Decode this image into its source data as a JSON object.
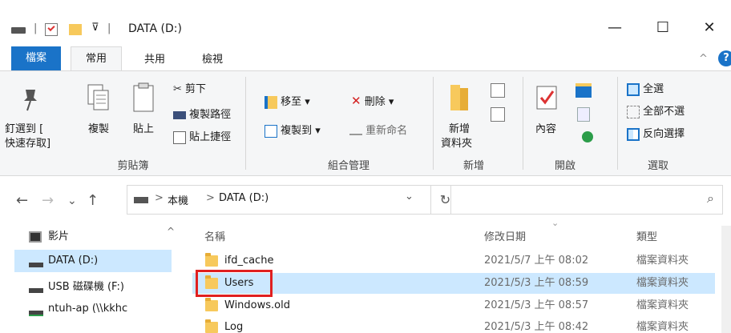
{
  "window": {
    "title": "DATA (D:)",
    "minimize_glyph": "—",
    "maximize_glyph": "☐",
    "close_glyph": "✕"
  },
  "quick_access": {
    "separator": "|",
    "dropdown": "⊽"
  },
  "tabs": [
    {
      "label": "檔案"
    },
    {
      "label": "常用"
    },
    {
      "label": "共用"
    },
    {
      "label": "檢視"
    }
  ],
  "ribbon": {
    "clipboard": {
      "group_label": "剪貼簿",
      "pin_label_1": "釘選到 [",
      "pin_label_2": "快速存取]",
      "copy_label": "複製",
      "paste_label": "貼上",
      "cut_label": "剪下",
      "copy_path_label": "複製路徑",
      "paste_shortcut_label": "貼上捷徑"
    },
    "organize": {
      "group_label": "組合管理",
      "move_to_label": "移至 ▾",
      "delete_label": "刪除 ▾",
      "copy_to_label": "複製到 ▾",
      "rename_label": "重新命名"
    },
    "new": {
      "group_label": "新增",
      "new_folder_label_1": "新增",
      "new_folder_label_2": "資料夾"
    },
    "open": {
      "group_label": "開啟",
      "properties_label": "內容"
    },
    "select": {
      "group_label": "選取",
      "select_all_label": "全選",
      "select_none_label": "全部不選",
      "invert_label": "反向選擇"
    },
    "collapse_glyph": "^",
    "help_glyph": "?"
  },
  "address": {
    "crumbs": [
      "本機",
      "DATA (D:)"
    ],
    "separator": ">",
    "dropdown_glyph": "⌄",
    "refresh_glyph": "↻",
    "search_glyph": "⌕"
  },
  "nav_pane": {
    "items": [
      {
        "label": "影片"
      },
      {
        "label": "DATA (D:)"
      },
      {
        "label": "USB 磁碟機 (F:)"
      },
      {
        "label": "ntuh-ap (\\\\kkhc"
      }
    ]
  },
  "file_list": {
    "columns": {
      "name": "名稱",
      "modified": "修改日期",
      "type": "類型"
    },
    "rows": [
      {
        "name": "ifd_cache",
        "modified": "2021/5/7 上午 08:02",
        "type": "檔案資料夾"
      },
      {
        "name": "Users",
        "modified": "2021/5/3 上午 08:59",
        "type": "檔案資料夾"
      },
      {
        "name": "Windows.old",
        "modified": "2021/5/3 上午 08:57",
        "type": "檔案資料夾"
      },
      {
        "name": "Log",
        "modified": "2021/5/3 上午 08:42",
        "type": "檔案資料夾"
      }
    ]
  },
  "colors": {
    "accent": "#1a73c8",
    "selection": "#cce8ff",
    "highlight_box": "#e02020"
  }
}
